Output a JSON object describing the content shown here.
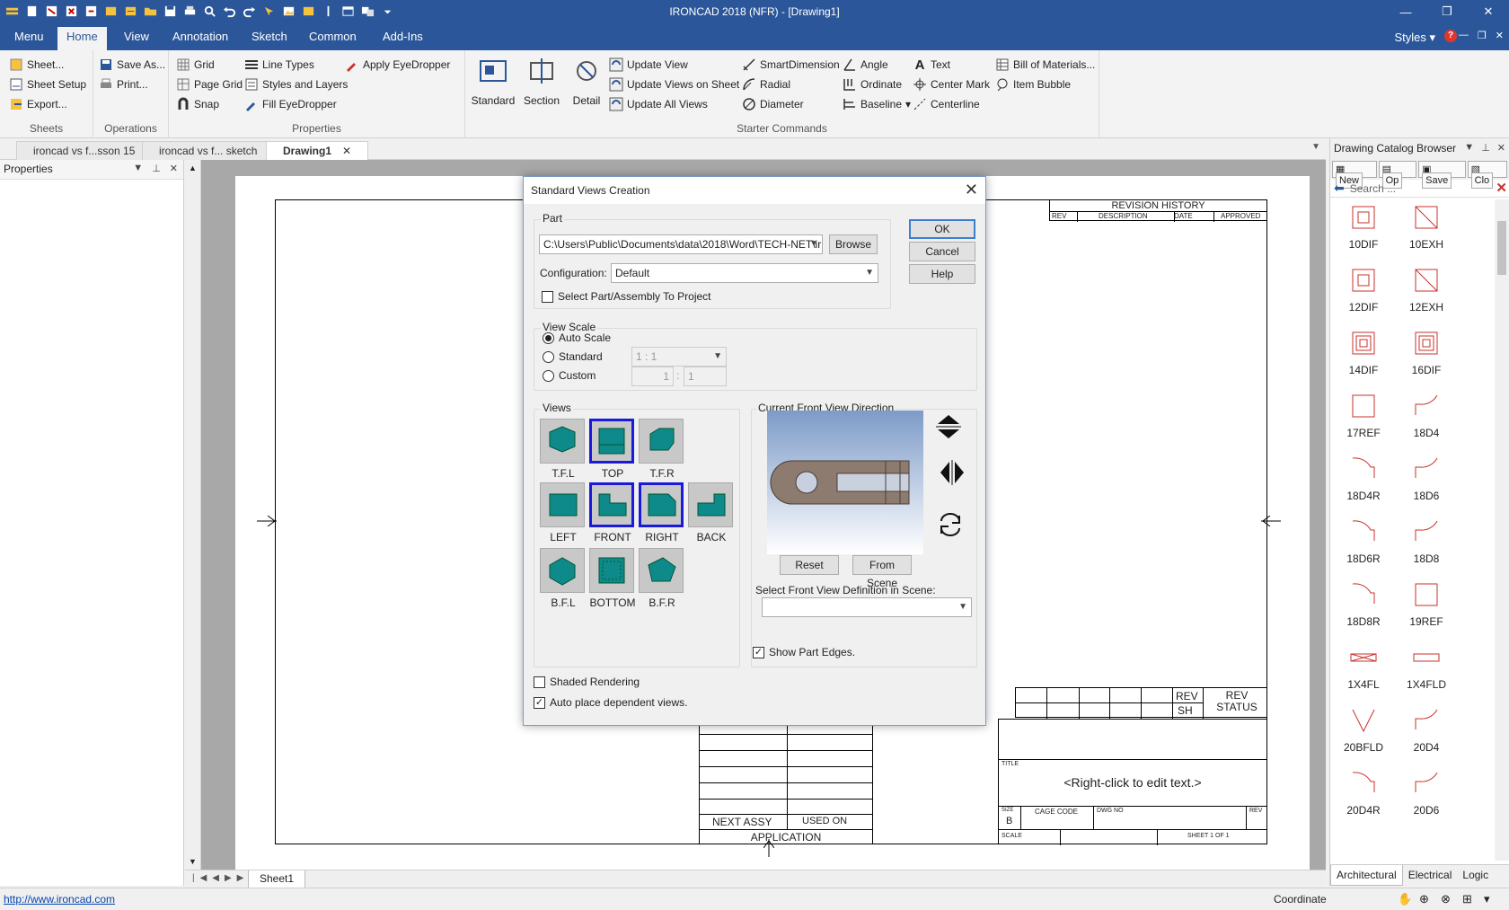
{
  "window": {
    "title": "IRONCAD 2018 (NFR) - [Drawing1]",
    "controls": [
      "—",
      "❐",
      "✕"
    ]
  },
  "ribbon_tabs": [
    "Menu",
    "Home",
    "View",
    "Annotation",
    "Sketch",
    "Common",
    "Add-Ins"
  ],
  "ribbon_right": {
    "styles": "Styles",
    "help": "?"
  },
  "ribbon": {
    "sheets": {
      "label": "Sheets",
      "items": [
        "Sheet...",
        "Sheet Setup",
        "Export..."
      ]
    },
    "operations": {
      "label": "Operations",
      "items": [
        "Save As...",
        "Print..."
      ]
    },
    "properties": {
      "label": "Properties",
      "col1": [
        "Grid",
        "Page Grid",
        "Snap"
      ],
      "col2": [
        "Line Types",
        "Styles and Layers",
        "Fill EyeDropper"
      ],
      "col3": [
        "Apply EyeDropper"
      ]
    },
    "starter": {
      "label": "Starter Commands",
      "big": [
        "Standard",
        "Section",
        "Detail"
      ],
      "update": [
        "Update View",
        "Update Views on Sheet",
        "Update All Views"
      ],
      "dims": [
        "SmartDimension",
        "Radial",
        "Diameter"
      ],
      "dims2": [
        "Angle",
        "Ordinate",
        "Baseline"
      ],
      "text": [
        "Text",
        "Center Mark",
        "Centerline"
      ],
      "bom": [
        "Bill of Materials...",
        "Item Bubble"
      ]
    }
  },
  "doc_tabs": [
    "ironcad vs f...sson 15",
    "ironcad vs f... sketch",
    "Drawing1"
  ],
  "properties_panel": {
    "title": "Properties"
  },
  "sheet_tab": "Sheet1",
  "title_block": {
    "revision_history": "REVISION HISTORY",
    "rev_cols": [
      "REV",
      "DESCRIPTION",
      "DATE",
      "APPROVED"
    ],
    "rev": "REV",
    "sh": "SH",
    "rev_status": "REV\nSTATUS",
    "title_label": "TITLE",
    "title_text": "<Right-click to edit text.>",
    "size_label": "SIZE",
    "size_value": "B",
    "cage_code": "CAGE CODE",
    "dwg_no": "DWG NO",
    "rev_label": "REV",
    "scale": "SCALE",
    "sheet": "SHEET 1 OF 1",
    "next_assy": "NEXT ASSY",
    "used_on": "USED ON",
    "application": "APPLICATION"
  },
  "catalog": {
    "title": "Drawing Catalog Browser",
    "tools": [
      "New",
      "Op",
      "Save",
      "Clo"
    ],
    "search_placeholder": "Search ...",
    "items": [
      "10DIF",
      "10EXH",
      "12DIF",
      "12EXH",
      "14DIF",
      "16DIF",
      "17REF",
      "18D4",
      "18D4R",
      "18D6",
      "18D6R",
      "18D8",
      "18D8R",
      "19REF",
      "1X4FL",
      "1X4FLD",
      "20BFLD",
      "20D4",
      "20D4R",
      "20D6"
    ],
    "bottom_tabs": [
      "Architectural",
      "Electrical",
      "Logic"
    ]
  },
  "status": {
    "link": "http://www.ironcad.com",
    "coordinate": "Coordinate"
  },
  "dialog": {
    "title": "Standard Views Creation",
    "part_label": "Part",
    "part_path": "C:\\Users\\Public\\Documents\\data\\2018\\Word\\TECH-NET\\ir",
    "browse": "Browse",
    "configuration_label": "Configuration:",
    "configuration_value": "Default",
    "select_part_label": "Select Part/Assembly To Project",
    "ok": "OK",
    "cancel": "Cancel",
    "help": "Help",
    "view_scale_label": "View Scale",
    "auto_scale": "Auto Scale",
    "standard": "Standard",
    "standard_value": "1 : 1",
    "custom": "Custom",
    "custom_a": "1",
    "custom_sep": ":",
    "custom_b": "1",
    "views_label": "Views",
    "views": [
      "T.F.L",
      "TOP",
      "T.F.R",
      "LEFT",
      "FRONT",
      "RIGHT",
      "BACK",
      "B.F.L",
      "BOTTOM",
      "B.F.R"
    ],
    "front_dir_label": "Current Front View Direction",
    "reset": "Reset",
    "from_scene": "From Scene",
    "select_front_label": "Select Front View Definition in Scene:",
    "show_edges": "Show Part Edges.",
    "shaded": "Shaded Rendering",
    "auto_place": "Auto place dependent views."
  },
  "colors": {
    "accent": "#2b579a",
    "teal": "#0f8a8a",
    "selected": "#1a1ad8",
    "catalog_icon": "#c9312c"
  }
}
